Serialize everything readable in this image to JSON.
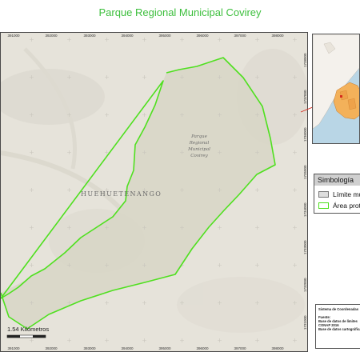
{
  "title": "Parque Regional Municipal Covirey",
  "map": {
    "region_label": "HUEHUETENANGO",
    "park_label_lines": [
      "Parque",
      "Regional",
      "Municipal",
      "Covirey"
    ],
    "scale_label": "1.54 Kilómetros",
    "x_ticks_top": [
      "391000",
      "392000",
      "393000",
      "394000",
      "395000",
      "396000",
      "397000",
      "398000"
    ],
    "x_ticks_bottom": [
      "391000",
      "392000",
      "393000",
      "394000",
      "395000",
      "396000",
      "397000",
      "398000"
    ],
    "y_ticks_right": [
      "1738000",
      "1737000",
      "1736000",
      "1735000",
      "1734000",
      "1733000",
      "1732000",
      "1731000",
      "1730000"
    ],
    "colors": {
      "boundary": "#4fe01f",
      "terrain": "#e6e3da",
      "park_fill": "#d7d6c6"
    }
  },
  "legend": {
    "title": "Simbología",
    "items": [
      {
        "label": "Límite municipal",
        "swatch": "limit"
      },
      {
        "label": "Área protegida",
        "swatch": "area"
      }
    ]
  },
  "sources": {
    "system": "Sistema de Coordenadas",
    "heading": "Fuente:",
    "lines": [
      "Base de datos de límites",
      "CONAP 2016",
      "Base de datos cartográfica"
    ]
  },
  "inset": {
    "colors": {
      "sea": "#b9d6e6",
      "land": "#f4f1ec",
      "highlight": "#f3b15a",
      "marker": "#d62b1e"
    }
  }
}
